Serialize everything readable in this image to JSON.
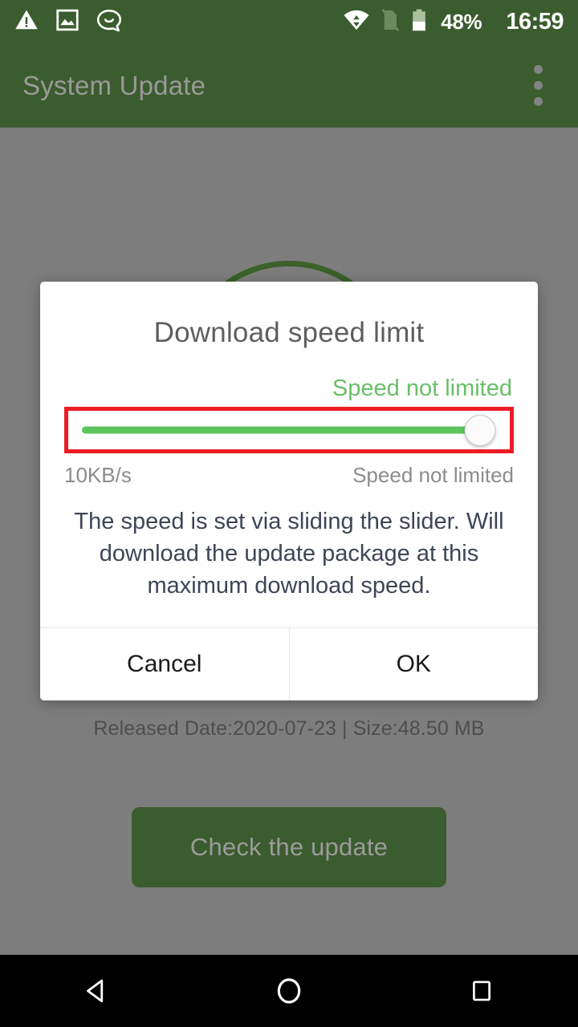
{
  "status_bar": {
    "icons": [
      "warning-triangle-icon",
      "image-icon",
      "chat-bubble-icon",
      "wifi-data-icon",
      "sim-off-icon",
      "battery-icon"
    ],
    "battery_percent": "48%",
    "time": "16:59"
  },
  "app_bar": {
    "title": "System Update",
    "overflow": "overflow-menu-icon"
  },
  "background": {
    "meta": "Released Date:2020-07-23  |  Size:48.50 MB",
    "check_button": "Check the update"
  },
  "dialog": {
    "title": "Download speed limit",
    "speed_value": "Speed not limited",
    "slider": {
      "percent": 100,
      "min_label": "10KB/s",
      "max_label": "Speed not limited"
    },
    "description": "The speed is set via sliding the slider. Will download the update package at this maximum download speed.",
    "cancel_label": "Cancel",
    "ok_label": "OK"
  },
  "nav_bar": {
    "back": "back-icon",
    "home": "home-icon",
    "recents": "recents-icon"
  },
  "colors": {
    "brand_green": "#3b5c2e",
    "accent_green": "#6abf69",
    "slider_green": "#5cc45c",
    "highlight_red": "#ec1c24",
    "scrim_gray": "#7d7d7d"
  }
}
